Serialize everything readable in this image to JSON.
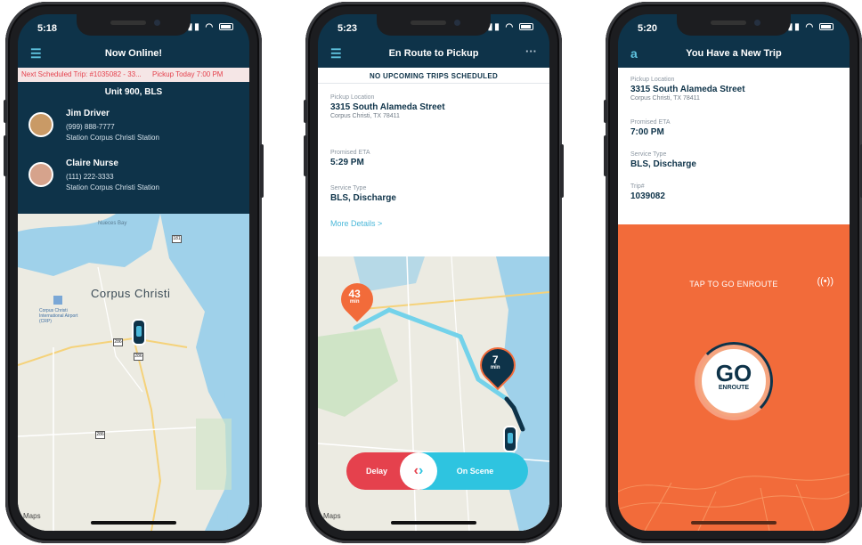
{
  "phone1": {
    "time": "5:18",
    "title": "Now Online!",
    "banner_trip": "Next Scheduled Trip: #1035082 - 33...",
    "banner_pickup": "Pickup Today 7:00 PM",
    "unit": "Unit 900, BLS",
    "crew": [
      {
        "name": "Jim Driver",
        "phone": "(999) 888-7777",
        "station": "Station Corpus Christi Station"
      },
      {
        "name": "Claire Nurse",
        "phone": "(111) 222-3333",
        "station": "Station Corpus Christi Station"
      }
    ],
    "map": {
      "city": "Corpus Christi",
      "maps_label": "Maps",
      "places": [
        "Nueces Bay",
        "Corpus Christi International Airport (CRP)"
      ]
    }
  },
  "phone2": {
    "time": "5:23",
    "title": "En Route to Pickup",
    "header": "NO UPCOMING TRIPS SCHEDULED",
    "fields": [
      {
        "label": "Pickup Location",
        "value": "3315 South Alameda Street",
        "sub": "Corpus Christi, TX 78411"
      },
      {
        "label": "Promised ETA",
        "value": "5:29 PM"
      },
      {
        "label": "Service Type",
        "value": "BLS, Discharge"
      }
    ],
    "more": "More Details >",
    "pin_a": {
      "value": "43",
      "unit": "min"
    },
    "pin_b": {
      "value": "7",
      "unit": "min"
    },
    "delay": "Delay",
    "on_scene": "On Scene",
    "maps_label": "Maps"
  },
  "phone3": {
    "time": "5:20",
    "title": "You Have a New Trip",
    "fields": [
      {
        "label": "Pickup Location",
        "value": "3315 South Alameda Street",
        "sub": "Corpus Christi, TX 78411"
      },
      {
        "label": "Promised ETA",
        "value": "7:00 PM"
      },
      {
        "label": "Service Type",
        "value": "BLS, Discharge"
      },
      {
        "label": "Trip#",
        "value": "1039082"
      }
    ],
    "tap": "TAP TO GO ENROUTE",
    "go": "GO",
    "enroute": "ENROUTE"
  },
  "colors": {
    "navy": "#0e3349",
    "red": "#e5414d",
    "cyan": "#2ec4e0",
    "orange": "#f26b3a"
  }
}
